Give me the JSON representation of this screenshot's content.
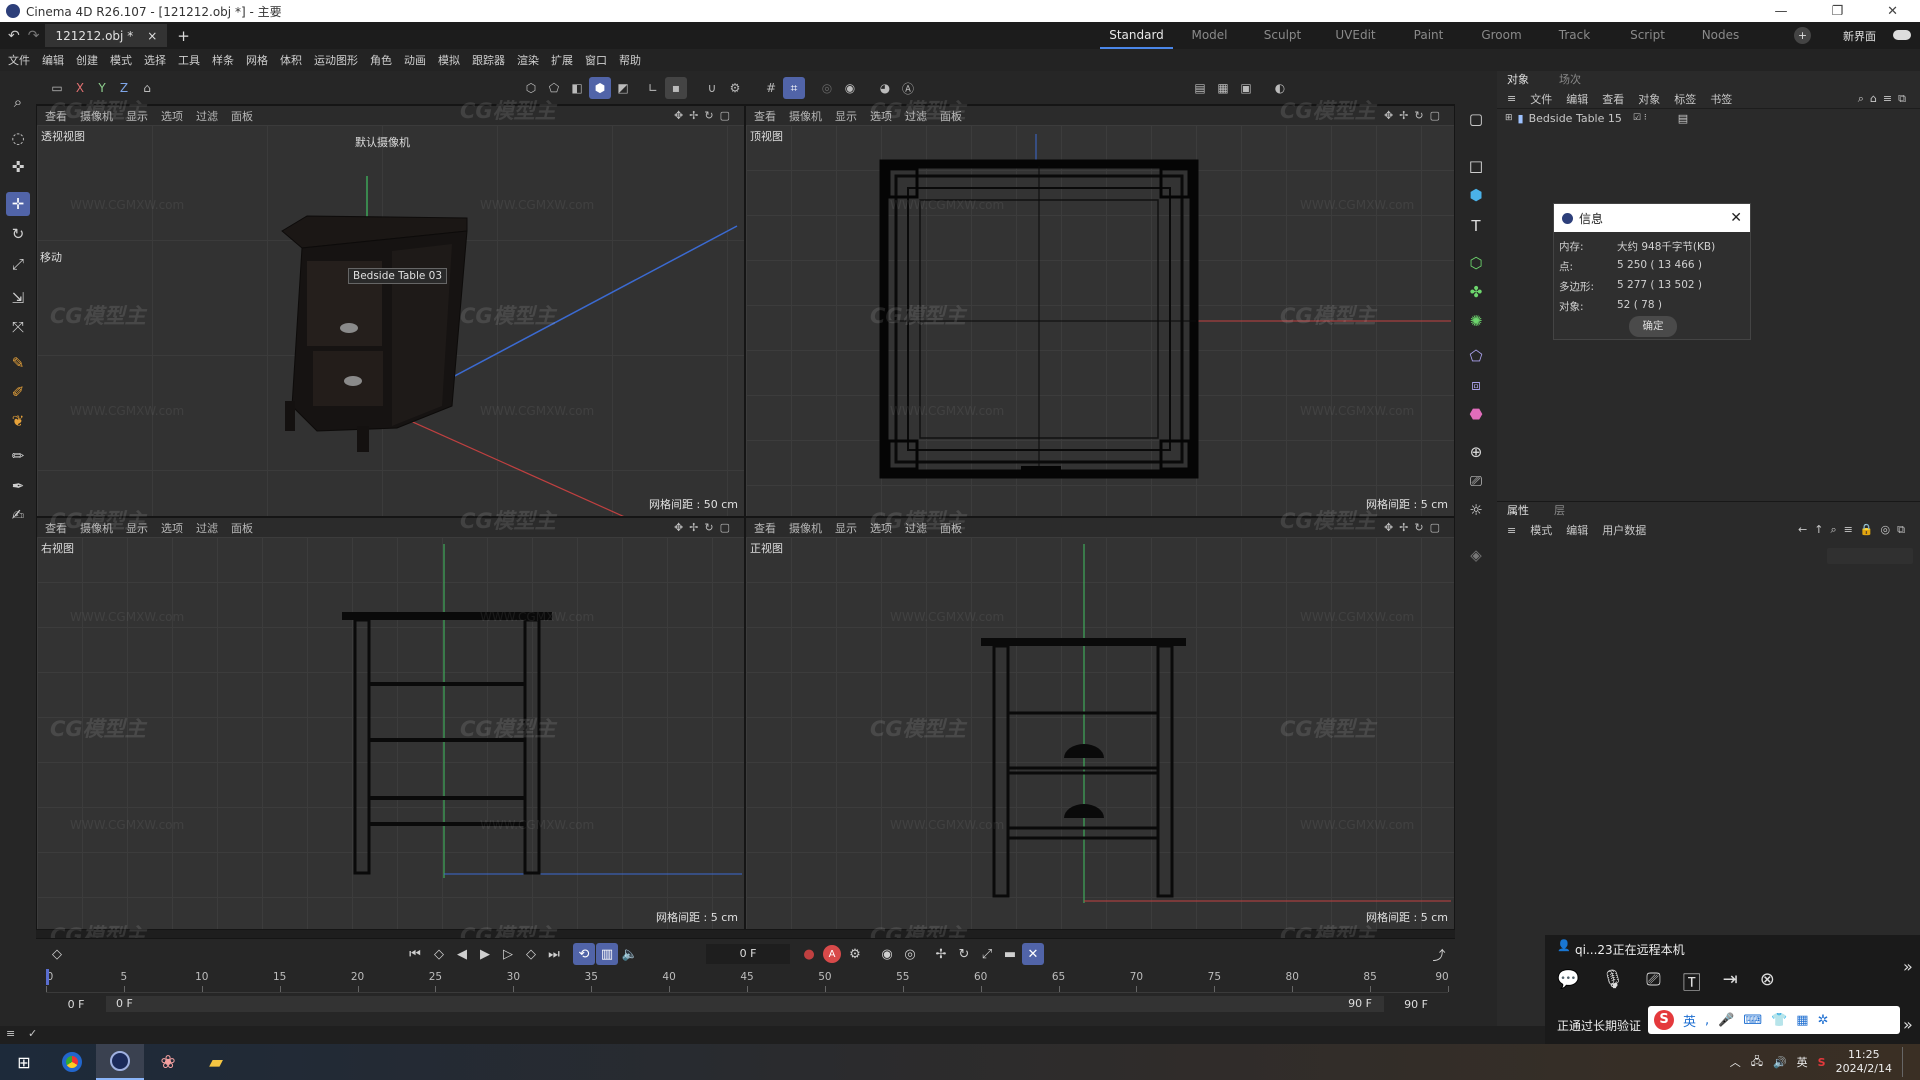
{
  "window": {
    "title": "Cinema 4D R26.107 - [121212.obj *] - 主要",
    "controls": [
      "—",
      "❐",
      "✕"
    ]
  },
  "file_tab": {
    "label": "121212.obj *",
    "close": "×",
    "add": "+"
  },
  "layouts": {
    "items": [
      "Standard",
      "Model",
      "Sculpt",
      "UVEdit",
      "Paint",
      "Groom",
      "Track",
      "Script",
      "Nodes"
    ],
    "new_layout": "新界面"
  },
  "menu": [
    "文件",
    "编辑",
    "创建",
    "模式",
    "选择",
    "工具",
    "样条",
    "网格",
    "体积",
    "运动图形",
    "角色",
    "动画",
    "模拟",
    "跟踪器",
    "渲染",
    "扩展",
    "窗口",
    "帮助"
  ],
  "toolbar": {
    "axes": [
      "X",
      "Y",
      "Z"
    ]
  },
  "viewport_menu": [
    "查看",
    "摄像机",
    "显示",
    "选项",
    "过滤",
    "面板"
  ],
  "viewports": {
    "perspective": {
      "label": "透视视图",
      "camera": "默认摄像机",
      "grid": "网格间距 : 50 cm",
      "tool": "移动",
      "tooltip": "Bedside Table 03"
    },
    "top": {
      "label": "顶视图",
      "grid": "网格间距 : 5 cm"
    },
    "right": {
      "label": "右视图",
      "grid": "网格间距 : 5 cm"
    },
    "front": {
      "label": "正视图",
      "grid": "网格间距 : 5 cm"
    }
  },
  "watermark": {
    "logo": "CG模型主",
    "url": "WWW.CGMXW.com"
  },
  "objects_panel": {
    "tabs": [
      "对象",
      "场次"
    ],
    "menu": [
      "文件",
      "编辑",
      "查看",
      "对象",
      "标签",
      "书签"
    ],
    "item": "Bedside Table 15"
  },
  "info_dialog": {
    "title": "信息",
    "rows": [
      {
        "k": "内存:",
        "v": "大约 948千字节(KB)"
      },
      {
        "k": "点:",
        "v": "5 250 ( 13 466 )"
      },
      {
        "k": "多边形:",
        "v": "5 277 ( 13 502 )"
      },
      {
        "k": "对象:",
        "v": "52 ( 78 )"
      }
    ],
    "ok": "确定"
  },
  "attributes_panel": {
    "tabs": [
      "属性",
      "层"
    ],
    "menu": [
      "模式",
      "编辑",
      "用户数据"
    ]
  },
  "timeline": {
    "frame": "0 F",
    "start": "0 F",
    "start2": "0 F",
    "end": "90 F",
    "end2": "90 F",
    "ticks": [
      "0",
      "5",
      "10",
      "15",
      "20",
      "25",
      "30",
      "35",
      "40",
      "45",
      "50",
      "55",
      "60",
      "65",
      "70",
      "75",
      "80",
      "85",
      "90"
    ]
  },
  "remote": {
    "user": "qi...23正在远程本机",
    "status": "正通过长期验证"
  },
  "ime": {
    "lang": "英"
  },
  "taskbar": {
    "time": "11:25",
    "date": "2024/2/14",
    "lang": "英"
  }
}
